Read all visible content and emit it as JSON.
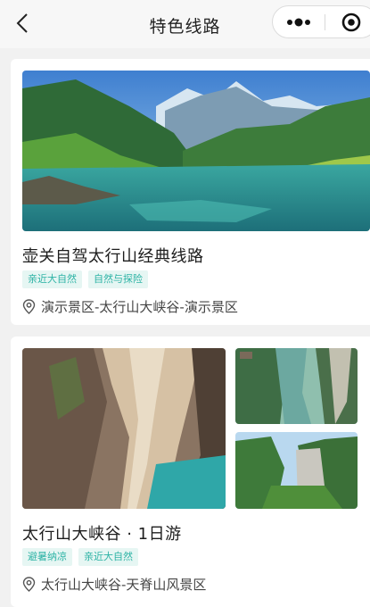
{
  "header": {
    "title": "特色线路",
    "back_icon": "chevron-left-icon",
    "more_icon": "more-dots-icon",
    "close_icon": "target-close-icon"
  },
  "routes": [
    {
      "title": "壶关自驾太行山经典线路",
      "tags": [
        "亲近大自然",
        "自然与探险"
      ],
      "location": "演示景区-太行山大峡谷-演示景区",
      "location_icon": "location-pin-icon"
    },
    {
      "title": "太行山大峡谷 · 1日游",
      "tags": [
        "避暑纳凉",
        "亲近大自然"
      ],
      "location": "太行山大峡谷-天脊山风景区",
      "location_icon": "location-pin-icon"
    }
  ],
  "colors": {
    "tag_text": "#2db3a5",
    "tag_bg": "#e6f6f3",
    "page_bg": "#f1f1f1"
  }
}
